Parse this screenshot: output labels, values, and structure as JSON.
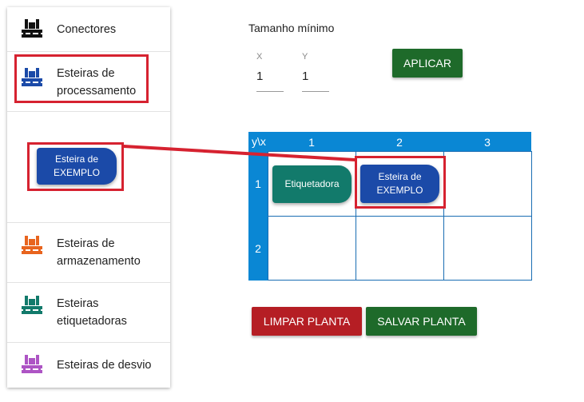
{
  "sidebar": {
    "items": [
      {
        "label": "Conectores",
        "icon": "pallet-black-icon",
        "color": "#111111"
      },
      {
        "label": "Esteiras de processamento",
        "icon": "pallet-blue-icon",
        "color": "#1b4aa8"
      },
      {
        "label": "Esteiras de armazenamento",
        "icon": "pallet-orange-icon",
        "color": "#e8641e"
      },
      {
        "label": "Esteiras etiquetadoras",
        "icon": "pallet-teal-icon",
        "color": "#127a6b"
      },
      {
        "label": "Esteiras de desvio",
        "icon": "pallet-purple-icon",
        "color": "#ad54c4"
      }
    ],
    "example_chip": "Esteira de EXEMPLO"
  },
  "size_panel": {
    "title": "Tamanho mínimo",
    "x_label": "X",
    "x_value": "1",
    "y_label": "Y",
    "y_value": "1",
    "apply_label": "APLICAR"
  },
  "grid": {
    "corner": "y\\x",
    "columns": [
      "1",
      "2",
      "3"
    ],
    "rows": [
      "1",
      "2"
    ],
    "cells": [
      {
        "row": "1",
        "col": "1",
        "label": "Etiquetadora",
        "color": "#127a6b"
      },
      {
        "row": "1",
        "col": "2",
        "label": "Esteira de EXEMPLO",
        "color": "#1b4aa8"
      }
    ]
  },
  "actions": {
    "clear_label": "LIMPAR PLANTA",
    "save_label": "SALVAR PLANTA"
  },
  "colors": {
    "apply": "#1e6a2a",
    "clear": "#b51e24",
    "save": "#1e6a2a",
    "grid_header": "#0a87d4",
    "highlight": "#d62230"
  }
}
